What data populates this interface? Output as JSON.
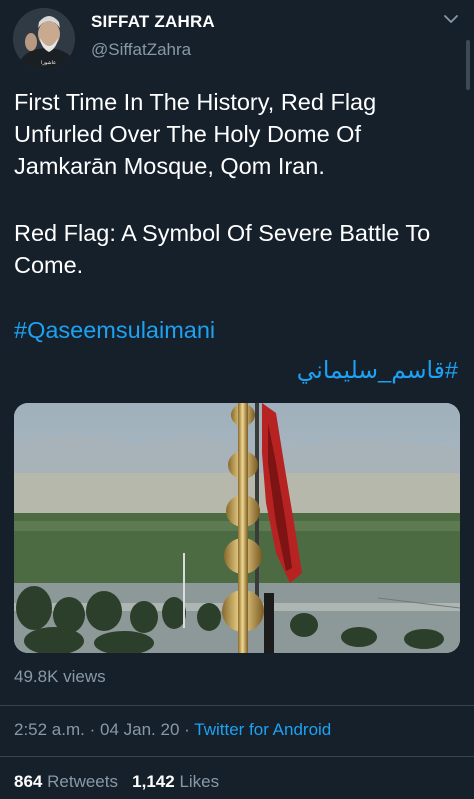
{
  "user": {
    "name": "SIFFAT ZAHRA",
    "handle": "@SiffatZahra"
  },
  "tweet": {
    "paragraph1": "First Time In The History, Red Flag Unfurled Over The Holy Dome Of Jamkarān Mosque, Qom Iran.",
    "paragraph2": "Red Flag: A Symbol Of Severe Battle To Come.",
    "hashtag1": "#Qaseemsulaimani",
    "hashtag2": "#قاسم_سليماني"
  },
  "media": {
    "description_icon": "video-thumbnail"
  },
  "views": "49.8K views",
  "meta": {
    "time": "2:52 a.m.",
    "sep1": "·",
    "date": "04 Jan. 20",
    "sep2": "·",
    "client": "Twitter for Android"
  },
  "stats": {
    "retweets_count": "864",
    "retweets_label": "Retweets",
    "likes_count": "1,142",
    "likes_label": "Likes"
  },
  "colors": {
    "background": "#15202b",
    "accent": "#1da1f2",
    "secondary_text": "#8899a6",
    "divider": "#38444d"
  }
}
